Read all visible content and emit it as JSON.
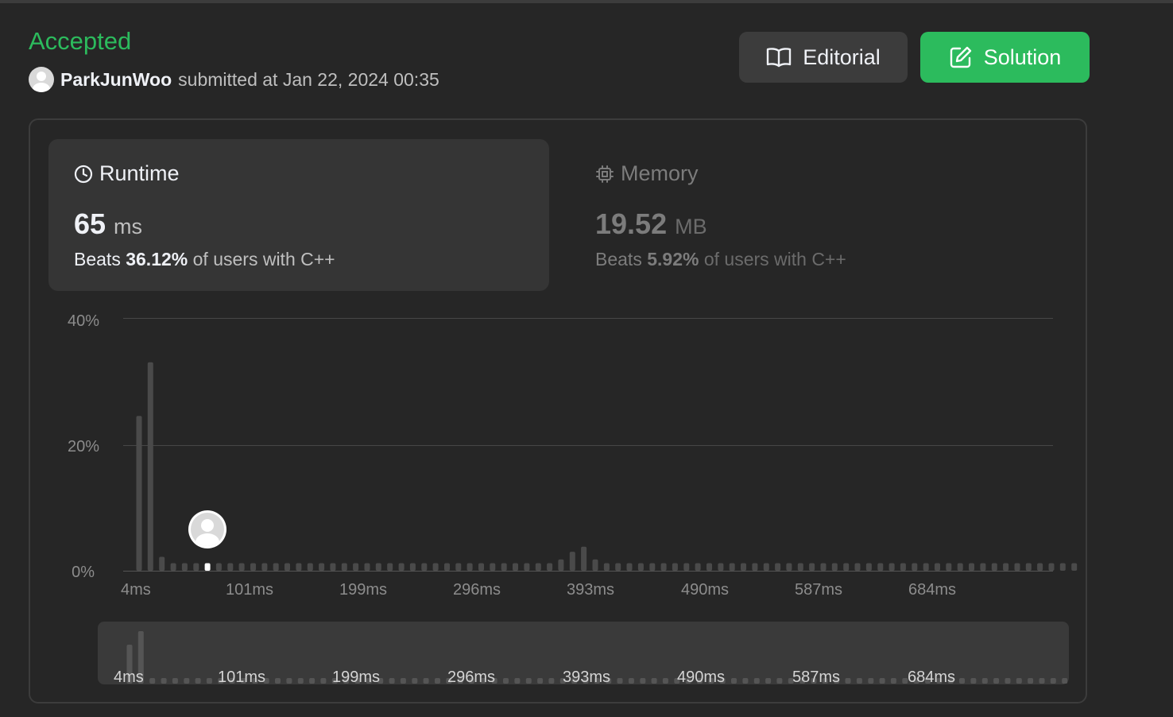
{
  "header": {
    "status": "Accepted",
    "username": "ParkJunWoo",
    "submitted_text": "submitted at Jan 22, 2024 00:35",
    "editorial_label": "Editorial",
    "solution_label": "Solution",
    "accent_color": "#2cbb5d"
  },
  "runtime": {
    "title": "Runtime",
    "value": "65",
    "unit": "ms",
    "beats_label": "Beats",
    "beats_pct": "36.12%",
    "beats_tail": "of users with C++",
    "icon": "clock-icon"
  },
  "memory": {
    "title": "Memory",
    "value": "19.52",
    "unit": "MB",
    "beats_label": "Beats",
    "beats_pct": "5.92%",
    "beats_tail": "of users with C++",
    "icon": "chip-icon"
  },
  "chart_data": {
    "type": "bar",
    "title": "",
    "xlabel": "",
    "ylabel": "",
    "ylim": [
      0,
      40
    ],
    "y_ticks": [
      "40%",
      "20%",
      "0%"
    ],
    "x_tick_labels": [
      "4ms",
      "101ms",
      "199ms",
      "296ms",
      "393ms",
      "490ms",
      "587ms",
      "684ms"
    ],
    "grid": true,
    "legend": "none",
    "highlight_index": 6,
    "highlight_label": "65 ms",
    "values": [
      24.5,
      33,
      2.2,
      1.2,
      1.2,
      1.2,
      1.2,
      1.2,
      1.2,
      1.2,
      1.2,
      1.2,
      1.2,
      1.2,
      1.2,
      1.2,
      1.2,
      1.2,
      1.2,
      1.2,
      1.2,
      1.2,
      1.2,
      1.2,
      1.2,
      1.2,
      1.2,
      1.2,
      1.2,
      1.2,
      1.2,
      1.2,
      1.2,
      1.2,
      1.2,
      1.2,
      1.2,
      1.8,
      3,
      3.8,
      1.8,
      1.2,
      1.2,
      1.2,
      1.2,
      1.2,
      1.2,
      1.2,
      1.2,
      1.2,
      1.2,
      1.2,
      1.2,
      1.2,
      1.2,
      1.2,
      1.2,
      1.2,
      1.2,
      1.2,
      1.2,
      1.2,
      1.2,
      1.2,
      1.2,
      1.2,
      1.2,
      1.2,
      1.2,
      1.2,
      1.2,
      1.2,
      1.2,
      1.2,
      1.2,
      1.2,
      1.2,
      1.2,
      1.2,
      1.2,
      1.2,
      1.2,
      1.2
    ]
  }
}
